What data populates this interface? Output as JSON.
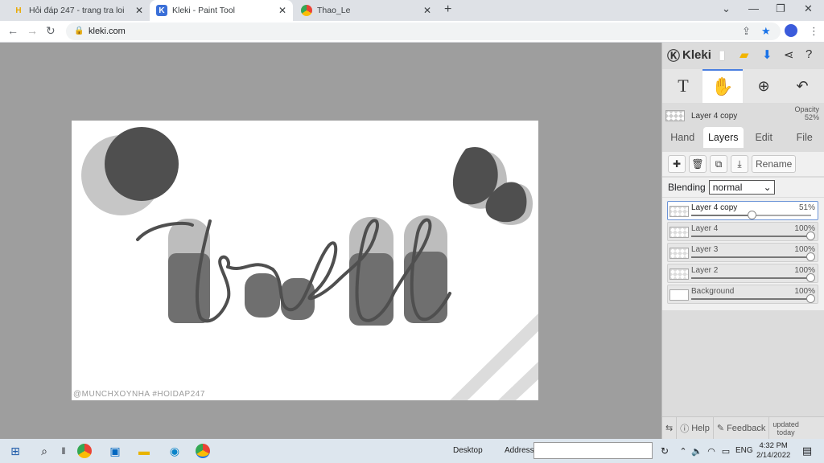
{
  "browser": {
    "tabs": [
      {
        "title": "Hỏi đáp 247 - trang tra loi",
        "favicon": "hoidap-icon",
        "close": "✕"
      },
      {
        "title": "Kleki - Paint Tool",
        "favicon": "kleki-icon",
        "close": "✕"
      },
      {
        "title": "Thao_Le",
        "favicon": "chrome-icon",
        "close": "✕"
      }
    ],
    "new_tab": "+",
    "url": "kleki.com"
  },
  "canvas": {
    "watermark": "@MUNCHXOYNHA #HOIDAP247",
    "colors": {
      "dark": "#555555",
      "shadow": "#bdbdbd",
      "mid": "#7a7a7a"
    }
  },
  "panel": {
    "brand": "Kleki",
    "current_layer": "Layer 4 copy",
    "opacity_label": "Opacity",
    "opacity_value": "52%",
    "tabs": [
      "Hand",
      "Layers",
      "Edit",
      "File"
    ],
    "active_tab": "Layers",
    "rename": "Rename",
    "blending_label": "Blending",
    "blending_value": "normal",
    "layers": [
      {
        "name": "Layer 4 copy",
        "opacity": "51%",
        "value": 0.51,
        "active": true
      },
      {
        "name": "Layer 4",
        "opacity": "100%",
        "value": 1.0,
        "active": false
      },
      {
        "name": "Layer 3",
        "opacity": "100%",
        "value": 1.0,
        "active": false
      },
      {
        "name": "Layer 2",
        "opacity": "100%",
        "value": 1.0,
        "active": false
      },
      {
        "name": "Background",
        "opacity": "100%",
        "value": 1.0,
        "active": false
      }
    ],
    "help": "Help",
    "feedback": "Feedback",
    "updated_line1": "updated",
    "updated_line2": "today"
  },
  "taskbar": {
    "desktop": "Desktop",
    "address": "Address",
    "lang": "ENG",
    "time": "4:32 PM",
    "date": "2/14/2022"
  }
}
